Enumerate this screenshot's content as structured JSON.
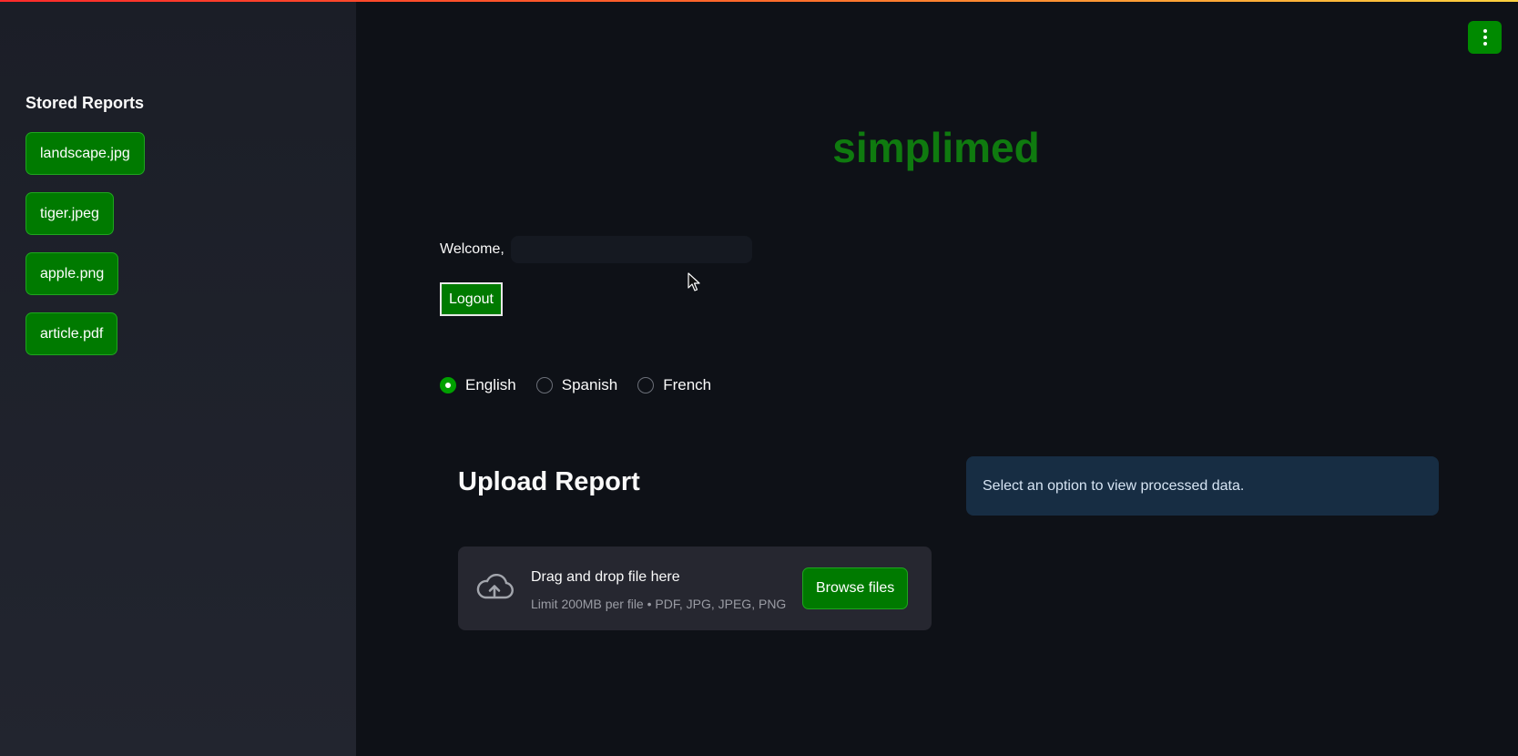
{
  "sidebar": {
    "title": "Stored Reports",
    "reports": [
      {
        "label": "landscape.jpg"
      },
      {
        "label": "tiger.jpeg"
      },
      {
        "label": "apple.png"
      },
      {
        "label": "article.pdf"
      }
    ]
  },
  "header": {
    "menu_icon": "vertical-ellipsis-icon"
  },
  "main": {
    "brand": "simplimed",
    "welcome_label": "Welcome,",
    "logout_label": "Logout",
    "languages": [
      {
        "label": "English",
        "selected": true
      },
      {
        "label": "Spanish",
        "selected": false
      },
      {
        "label": "French",
        "selected": false
      }
    ],
    "upload": {
      "title": "Upload Report",
      "drop_title": "Drag and drop file here",
      "drop_subtitle": "Limit 200MB per file • PDF, JPG, JPEG, PNG",
      "browse_label": "Browse files"
    },
    "info_message": "Select an option to view processed data."
  },
  "colors": {
    "accent": "#007a00",
    "brand": "#0f7a0f",
    "background": "#0e1117",
    "sidebar": "#1e2129",
    "info_bg": "#172d43"
  }
}
